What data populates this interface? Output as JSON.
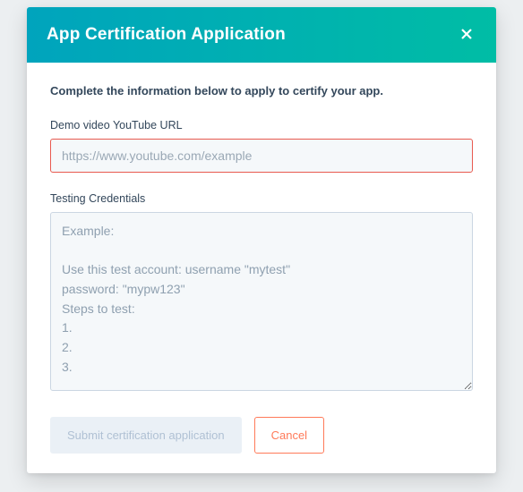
{
  "modal": {
    "title": "App Certification Application",
    "intro": "Complete the information below to apply to certify your app.",
    "demo": {
      "label": "Demo video YouTube URL",
      "placeholder": "https://www.youtube.com/example",
      "value": ""
    },
    "credentials": {
      "label": "Testing Credentials",
      "placeholder": "Example:\n\nUse this test account: username \"mytest\"\npassword: \"mypw123\"\nSteps to test:\n1.\n2.\n3.",
      "value": ""
    },
    "actions": {
      "submit": "Submit certification application",
      "cancel": "Cancel"
    }
  },
  "icons": {
    "close": "close-icon"
  }
}
